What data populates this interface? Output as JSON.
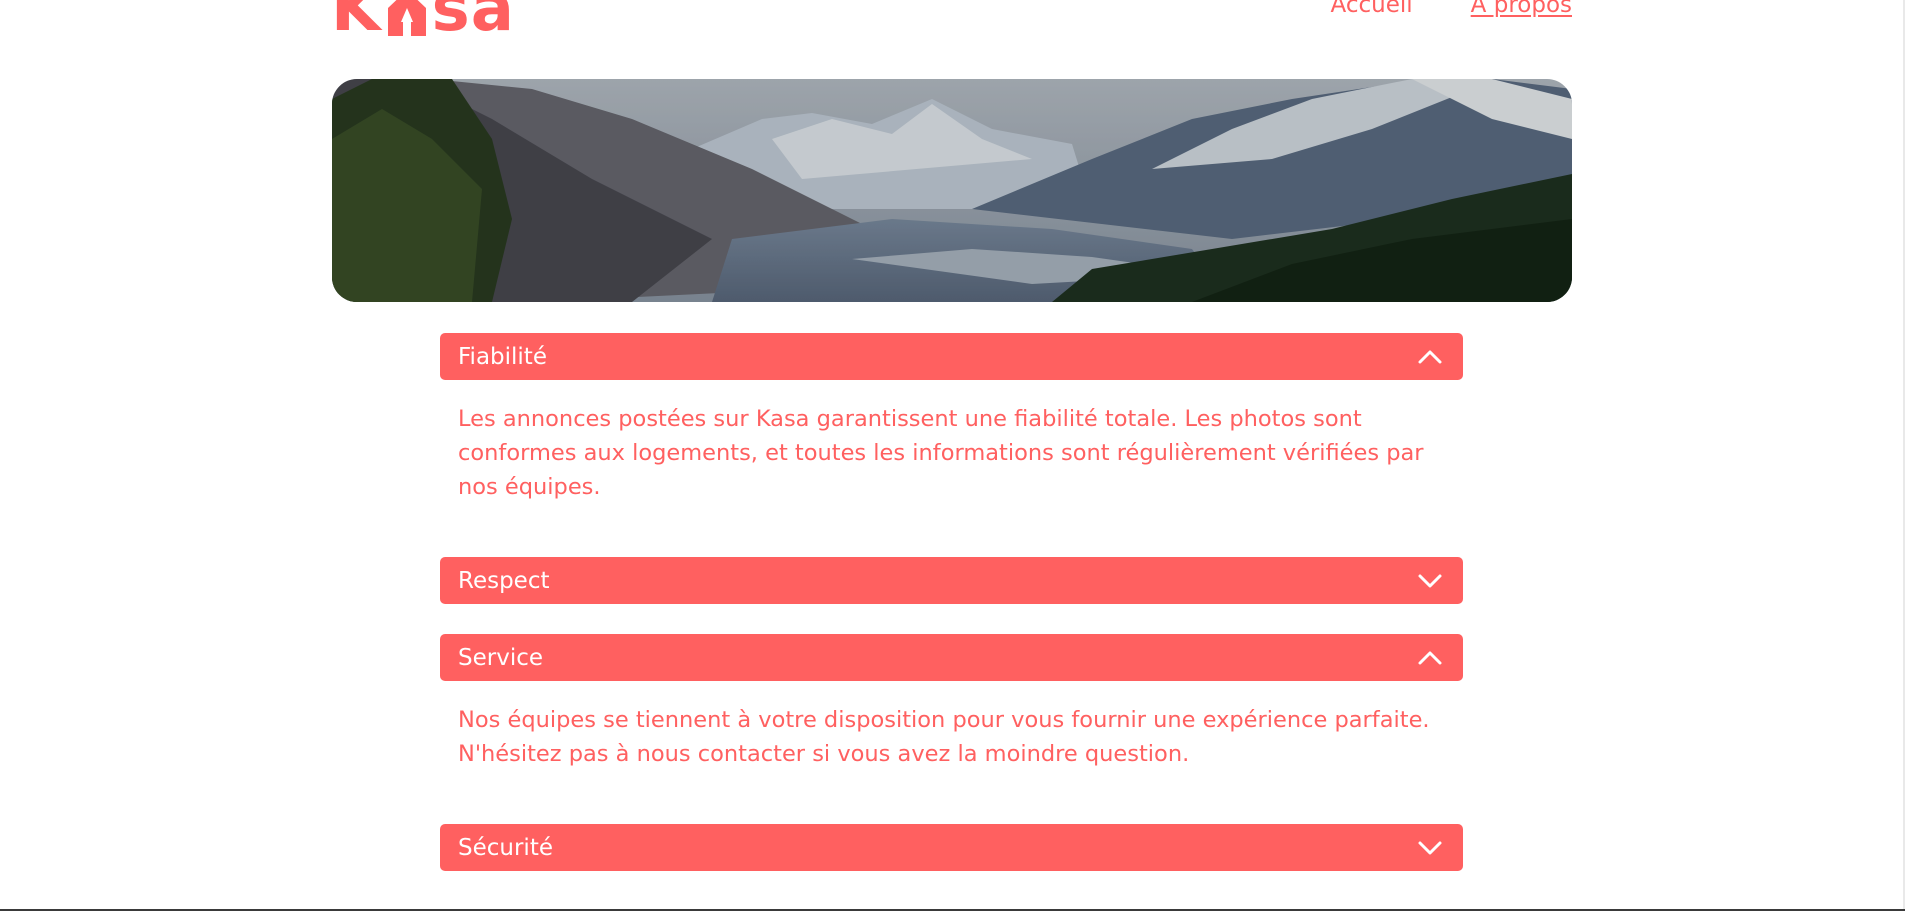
{
  "header": {
    "logo_text_start": "K",
    "logo_text_end": "sa",
    "nav": [
      {
        "label": "Accueil",
        "active": false
      },
      {
        "label": "A propos",
        "active": true
      }
    ]
  },
  "banner": {
    "alt": "mountain-landscape"
  },
  "colors": {
    "accent": "#FF6060",
    "text_on_accent": "#FFFFFF"
  },
  "sections": [
    {
      "title": "Fiabilité",
      "expanded": true,
      "icon": "chevron-up-icon",
      "content": "Les annonces postées sur Kasa garantissent une fiabilité totale. Les photos sont conformes aux logements, et toutes les informations sont régulièrement vérifiées par nos équipes."
    },
    {
      "title": "Respect",
      "expanded": false,
      "icon": "chevron-down-icon"
    },
    {
      "title": "Service",
      "expanded": true,
      "icon": "chevron-up-icon",
      "content": "Nos équipes se tiennent à votre disposition pour vous fournir une expérience parfaite. N'hésitez pas à nous contacter si vous avez la moindre question."
    },
    {
      "title": "Sécurité",
      "expanded": false,
      "icon": "chevron-down-icon"
    }
  ]
}
